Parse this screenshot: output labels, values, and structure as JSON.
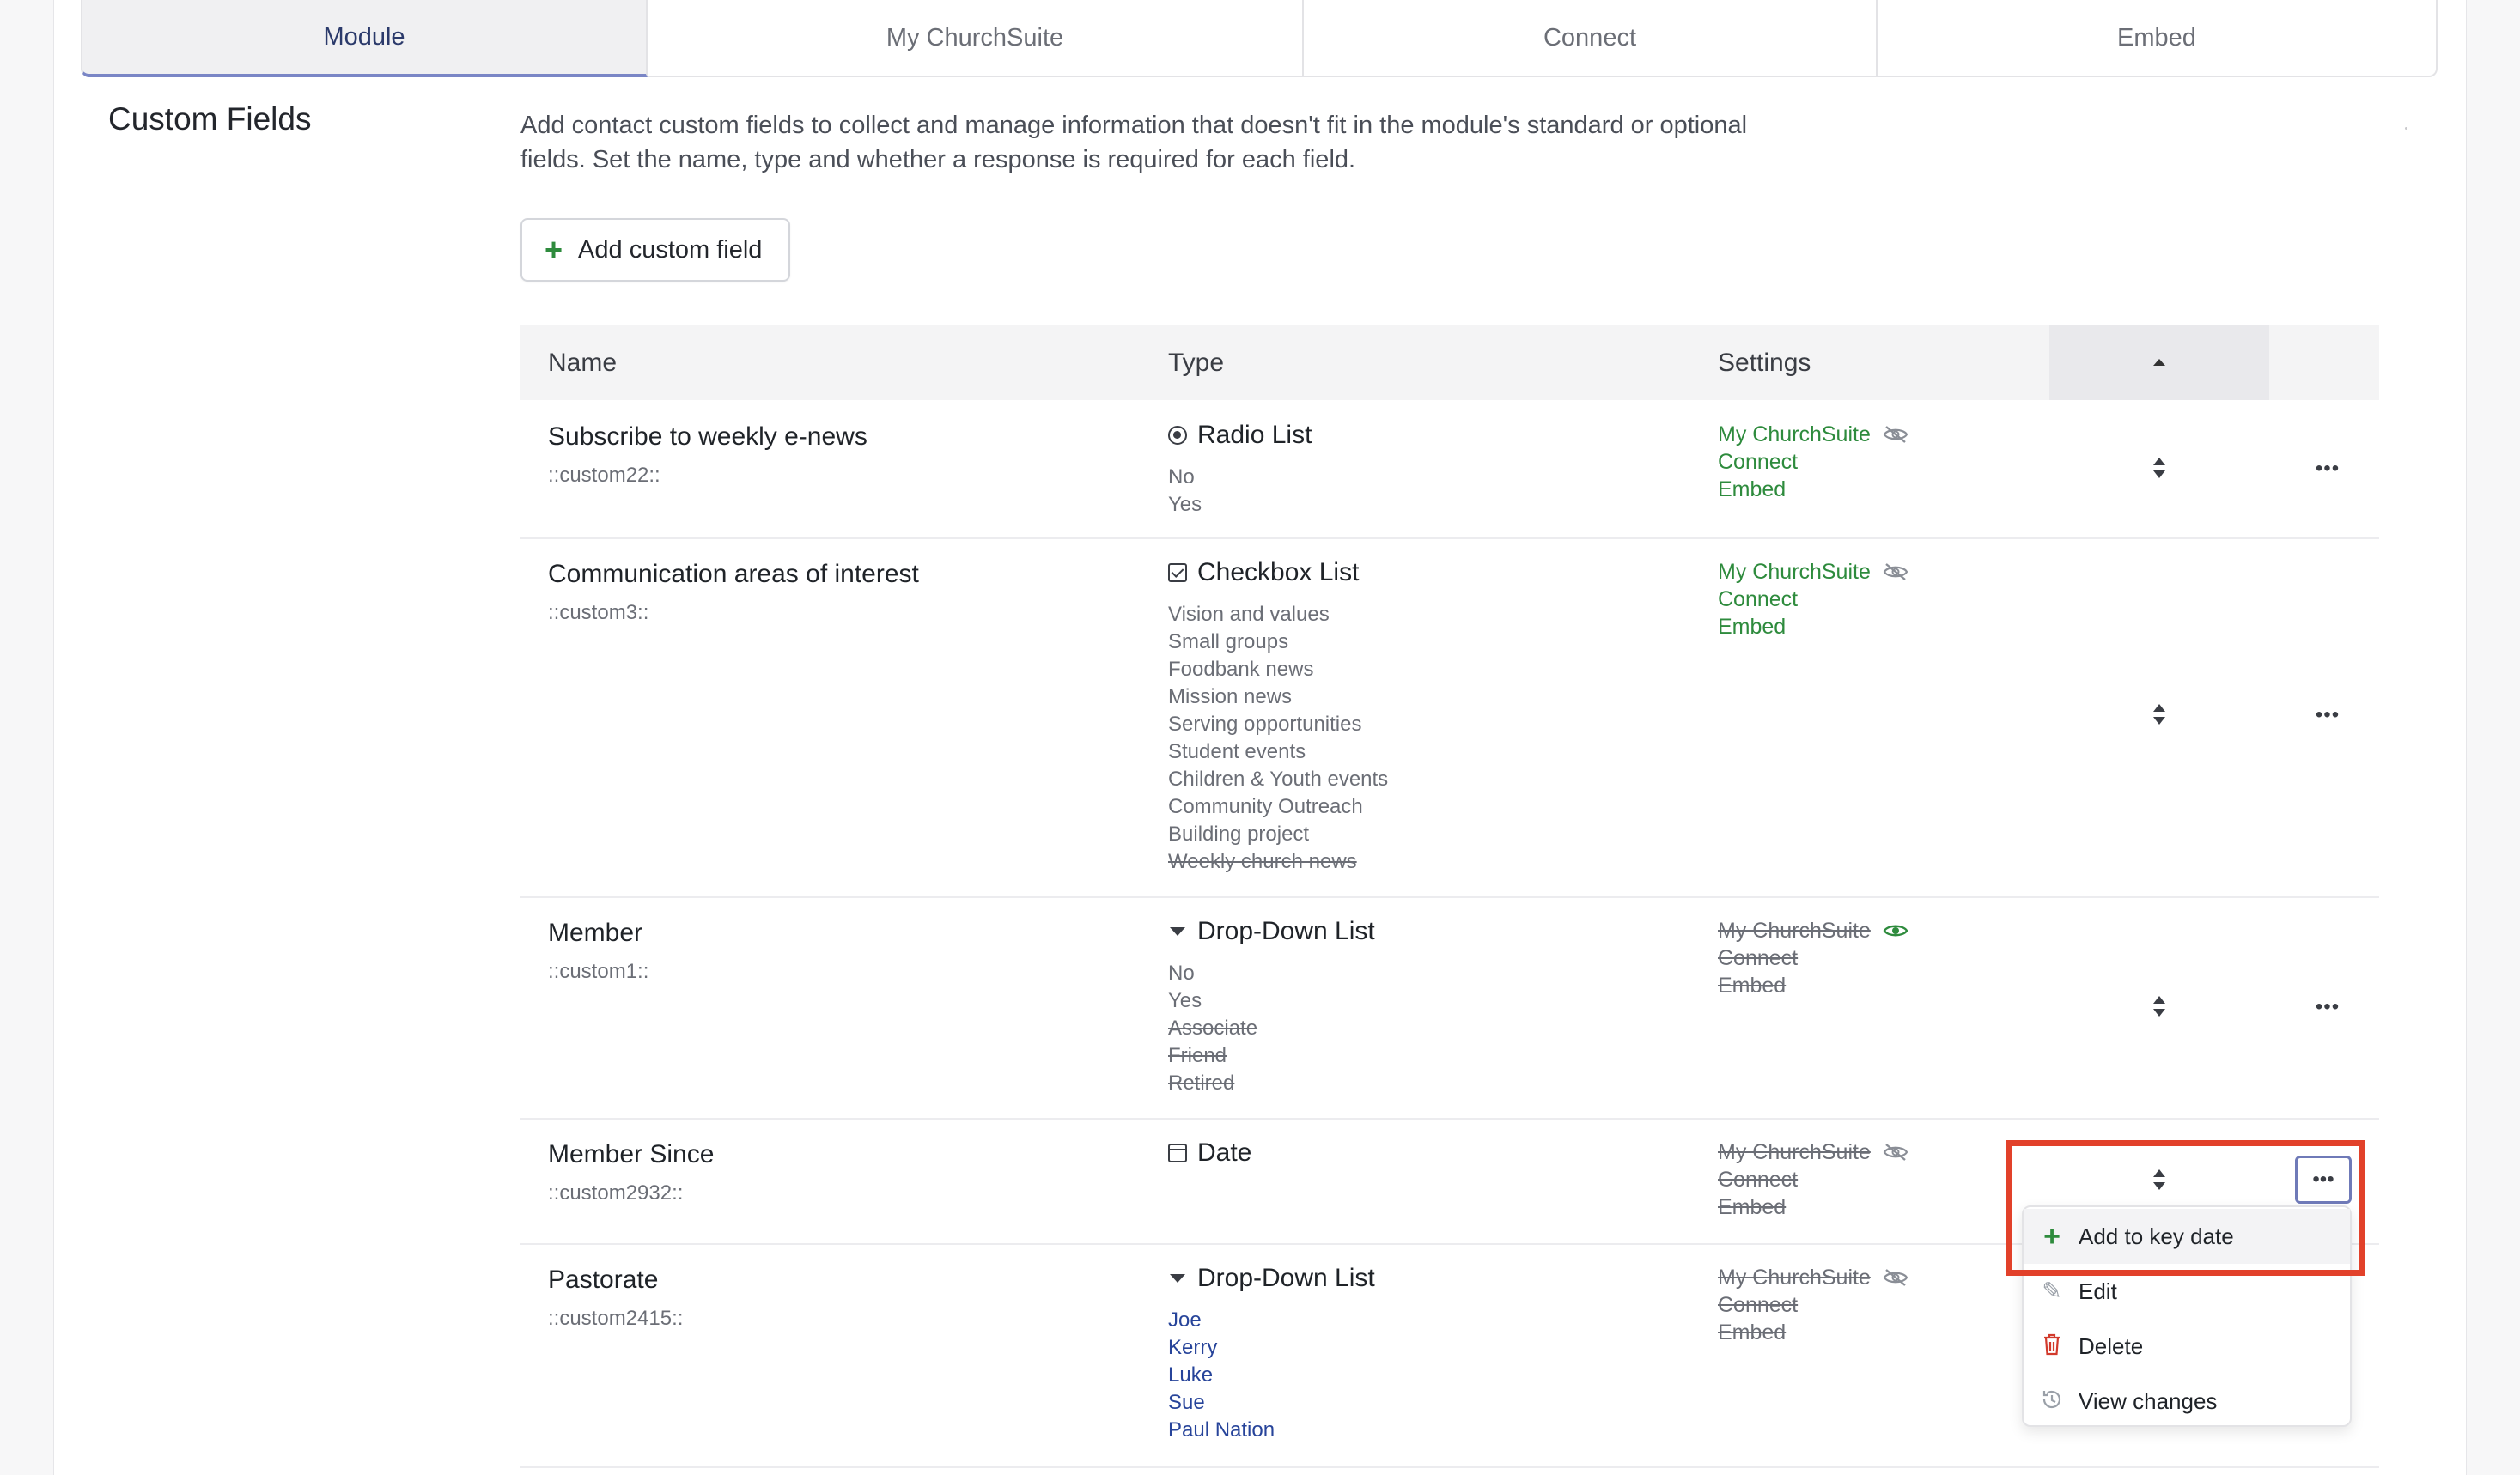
{
  "tabs": [
    {
      "label": "Module",
      "active": true
    },
    {
      "label": "My ChurchSuite",
      "active": false
    },
    {
      "label": "Connect",
      "active": false
    },
    {
      "label": "Embed",
      "active": false
    }
  ],
  "section": {
    "title": "Custom Fields",
    "description": "Add contact custom fields to collect and manage information that doesn't fit in the module's standard or optional fields. Set the name, type and whether a response is required for each field."
  },
  "add_button": {
    "label": "Add custom field",
    "icon": "plus-icon"
  },
  "table": {
    "headers": {
      "name": "Name",
      "type": "Type",
      "settings": "Settings"
    },
    "rows": [
      {
        "name": "Subscribe to weekly e-news",
        "code": "::custom22::",
        "type": "Radio List",
        "type_icon": "radio-icon",
        "options": [
          {
            "label": "No",
            "struck": false
          },
          {
            "label": "Yes",
            "struck": false
          }
        ],
        "settings": {
          "my_churchsuite": "My ChurchSuite",
          "connect": "Connect",
          "embed": "Embed",
          "enabled": true,
          "visibility_icon": "eye-slash-icon"
        }
      },
      {
        "name": "Communication areas of interest",
        "code": "::custom3::",
        "type": "Checkbox List",
        "type_icon": "checkbox-icon",
        "options": [
          {
            "label": "Vision and values",
            "struck": false
          },
          {
            "label": "Small groups",
            "struck": false
          },
          {
            "label": "Foodbank news",
            "struck": false
          },
          {
            "label": "Mission news",
            "struck": false
          },
          {
            "label": "Serving opportunities",
            "struck": false
          },
          {
            "label": "Student events",
            "struck": false
          },
          {
            "label": "Children & Youth events",
            "struck": false
          },
          {
            "label": "Community Outreach",
            "struck": false
          },
          {
            "label": "Building project",
            "struck": false
          },
          {
            "label": "Weekly church news",
            "struck": true
          }
        ],
        "settings": {
          "my_churchsuite": "My ChurchSuite",
          "connect": "Connect",
          "embed": "Embed",
          "enabled": true,
          "visibility_icon": "eye-slash-icon"
        }
      },
      {
        "name": "Member",
        "code": "::custom1::",
        "type": "Drop-Down List",
        "type_icon": "caret-down-icon",
        "options": [
          {
            "label": "No",
            "struck": false
          },
          {
            "label": "Yes",
            "struck": false
          },
          {
            "label": "Associate",
            "struck": true
          },
          {
            "label": "Friend",
            "struck": true
          },
          {
            "label": "Retired",
            "struck": true
          }
        ],
        "settings": {
          "my_churchsuite": "My ChurchSuite",
          "connect": "Connect",
          "embed": "Embed",
          "enabled": false,
          "visibility_icon": "eye-icon"
        }
      },
      {
        "name": "Member Since",
        "code": "::custom2932::",
        "type": "Date",
        "type_icon": "calendar-icon",
        "options": [],
        "settings": {
          "my_churchsuite": "My ChurchSuite",
          "connect": "Connect",
          "embed": "Embed",
          "enabled": false,
          "visibility_icon": "eye-slash-icon"
        }
      },
      {
        "name": "Pastorate",
        "code": "::custom2415::",
        "type": "Drop-Down List",
        "type_icon": "caret-down-icon",
        "options": [
          {
            "label": "Joe",
            "struck": false
          },
          {
            "label": "Kerry",
            "struck": false
          },
          {
            "label": "Luke",
            "struck": false
          },
          {
            "label": "Sue",
            "struck": false
          },
          {
            "label": "Paul Nation",
            "struck": false
          }
        ],
        "settings": {
          "my_churchsuite": "My ChurchSuite",
          "connect": "Connect",
          "embed": "Embed",
          "enabled": false,
          "visibility_icon": "eye-slash-icon"
        }
      }
    ]
  },
  "context_menu": {
    "items": [
      {
        "label": "Add to key date",
        "icon": "plus-icon"
      },
      {
        "label": "Edit",
        "icon": "pencil-icon"
      },
      {
        "label": "Delete",
        "icon": "trash-icon"
      },
      {
        "label": "View changes",
        "icon": "history-icon"
      }
    ]
  },
  "colors": {
    "enabled_green": "#2e8b3d",
    "link_blue": "#27449a",
    "highlight_red": "#e2412a",
    "active_tab_underline": "#7a86c6"
  }
}
